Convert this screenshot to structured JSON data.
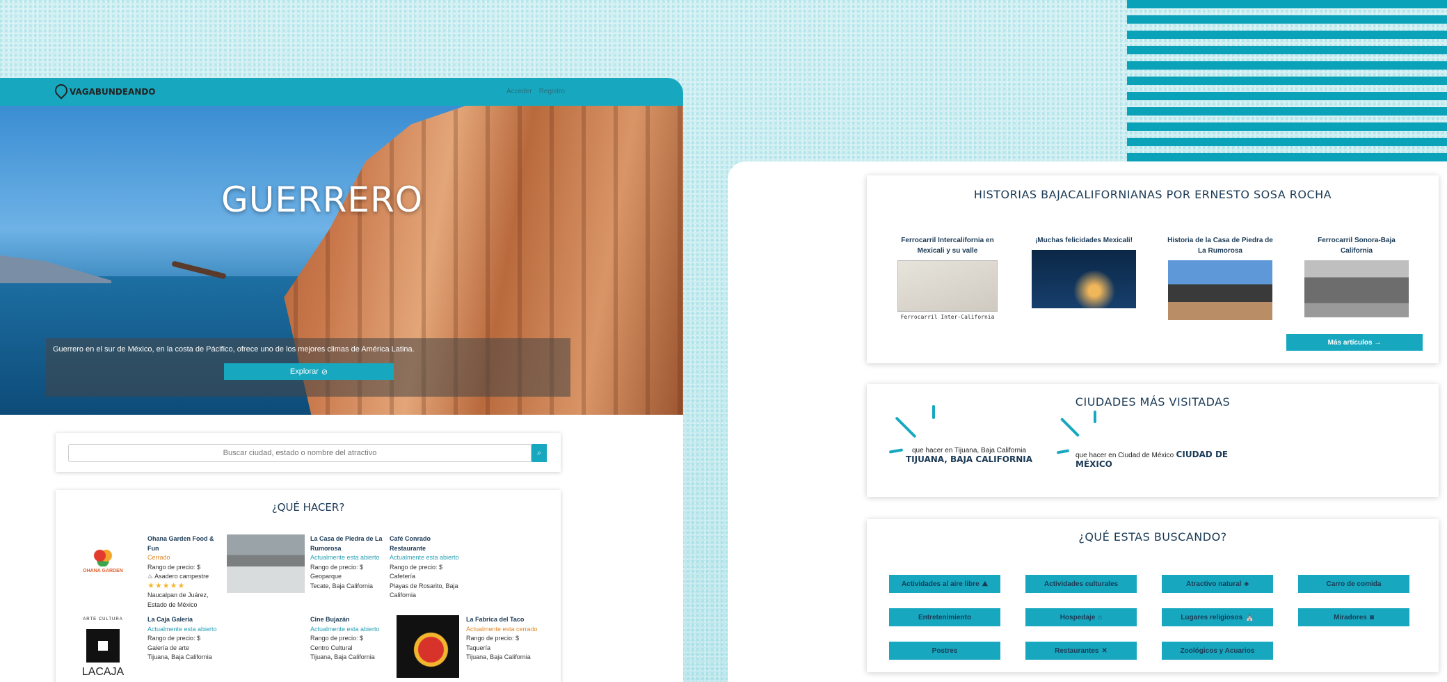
{
  "brand": {
    "name": "VAGABUNDEANDO"
  },
  "nav": {
    "login": "Acceder",
    "register": "Registro"
  },
  "hero": {
    "title": "GUERRERO",
    "description": "Guerrero en el sur de México, en la costa de Pácifico, ofrece uno de los mejores climas de América Latina.",
    "explore_label": "Explorar"
  },
  "search": {
    "placeholder": "Buscar ciudad, estado o nombre del atractivo"
  },
  "que_hacer": {
    "title": "¿QUÉ HACER?",
    "places": [
      {
        "name": "Ohana Garden Food & Fun",
        "status": "Cerrado",
        "price": "Rango de precio: $",
        "category": "Asadero campestre",
        "stars": "★★★★★",
        "location": "Naucalpan de Juárez, Estado de México"
      },
      {
        "name": "La Casa de Piedra de La Rumorosa",
        "status": "Actualmente esta abierto",
        "price": "Rango de precio: $",
        "category": "Geoparque",
        "location": "Tecate, Baja California"
      },
      {
        "name": "Café Conrado Restaurante",
        "status": "Actualmente esta abierto",
        "price": "Rango de precio: $",
        "category": "Cafetería",
        "location": "Playas de Rosarito, Baja California"
      },
      {
        "name": "La Caja Galería",
        "status": "Actualmente esta abierto",
        "price": "Rango de precio: $",
        "category": "Galería de arte",
        "location": "Tijuana, Baja California"
      },
      {
        "name": "Cine Bujazán",
        "status": "Actualmente esta abierto",
        "price": "Rango de precio: $",
        "category": "Centro Cultural",
        "location": "Tijuana, Baja California"
      },
      {
        "name": "La Fabrica del Taco",
        "status": "Actualmente esta cerrado",
        "price": "Rango de precio: $",
        "category": "Taquería",
        "location": "Tijuana, Baja California"
      }
    ],
    "logos": {
      "ohana": "OHANA GARDEN",
      "lacaja_top": "ARTE CULTURA",
      "lacaja_bottom_left": "LA",
      "lacaja_bottom_right": "CAJA"
    }
  },
  "historias": {
    "title": "HISTORIAS BAJACALIFORNIANAS POR ERNESTO SOSA ROCHA",
    "articles": [
      {
        "title": "Ferrocarril Intercalifornia en Mexicali y su valle",
        "caption": "Ferrocarril Inter-California"
      },
      {
        "title": "¡Muchas felicidades Mexicali!",
        "caption": ""
      },
      {
        "title": "Historia de la Casa de Piedra de La Rumorosa",
        "caption": ""
      },
      {
        "title": "Ferrocarril Sonora-Baja California",
        "caption": ""
      }
    ],
    "more_label": "Más artículos →"
  },
  "ciudades": {
    "title": "CIUDADES MÁS VISITADAS",
    "cities": [
      {
        "alt": "que hacer en Tijuana, Baja California",
        "name": "TIJUANA, BAJA CALIFORNIA"
      },
      {
        "alt": "que hacer en Ciudad de México",
        "name": "CIUDAD DE MÉXICO"
      }
    ]
  },
  "buscando": {
    "title": "¿QUÉ ESTAS BUSCANDO?",
    "categories": [
      "Actividades al aire libre",
      "Actividades culturales",
      "Atractivo natural",
      "Carro de comida",
      "Entretenimiento",
      "Hospedaje",
      "Lugares religiosos",
      "Miradores",
      "Postres",
      "Restaurantes",
      "Zoológicos y Acuarios"
    ]
  },
  "colors": {
    "accent": "#17a8c0",
    "heading": "#1b3a55",
    "open": "#2aa0b5",
    "closed": "#e08a2b"
  }
}
